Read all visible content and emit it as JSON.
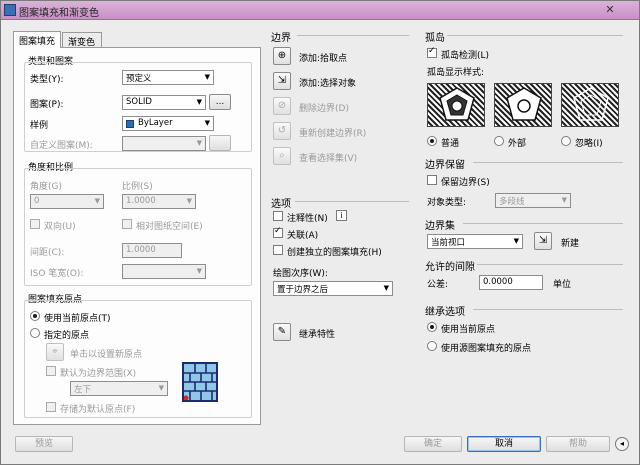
{
  "window": {
    "title": "图案填充和渐变色",
    "close_glyph": "✕"
  },
  "tabs": [
    {
      "label": "图案填充"
    },
    {
      "label": "渐变色"
    }
  ],
  "type_pattern": {
    "group_label": "类型和图案",
    "type_label": "类型(Y):",
    "type_value": "预定义",
    "pattern_label": "图案(P):",
    "pattern_value": "SOLID",
    "pattern_browse": "...",
    "color_label": "样例",
    "color_value": "ByLayer",
    "custom_label": "自定义图案(M):",
    "custom_value": ""
  },
  "angle_scale": {
    "group_label": "角度和比例",
    "angle_label": "角度(G)",
    "angle_value": "0",
    "scale_label": "比例(S)",
    "scale_value": "1.0000",
    "double_label": "双向(U)",
    "relative_label": "相对图纸空间(E)",
    "spacing_label": "间距(C):",
    "spacing_value": "1.0000",
    "iso_label": "ISO 笔宽(O):",
    "iso_value": ""
  },
  "origin": {
    "group_label": "图案填充原点",
    "use_current_label": "使用当前原点(T)",
    "specified_label": "指定的原点",
    "click_set_label": "单击以设置新原点",
    "default_extent_label": "默认为边界范围(X)",
    "position_value": "左下",
    "store_default_label": "存储为默认原点(F)"
  },
  "boundary": {
    "group_label": "边界",
    "add_pick_label": "添加:拾取点",
    "add_select_label": "添加:选择对象",
    "remove_label": "删除边界(D)",
    "recreate_label": "重新创建边界(R)",
    "view_sel_label": "查看选择集(V)"
  },
  "options": {
    "group_label": "选项",
    "annotative_label": "注释性(N)",
    "info_glyph": "i",
    "associative_label": "关联(A)",
    "separate_label": "创建独立的图案填充(H)",
    "draw_order_label": "绘图次序(W):",
    "draw_order_value": "置于边界之后"
  },
  "inherit_label": "继承特性",
  "islands": {
    "group_label": "孤岛",
    "detect_label": "孤岛检测(L)",
    "style_label": "孤岛显示样式:",
    "normal_label": "普通",
    "outer_label": "外部",
    "ignore_label": "忽略(I)"
  },
  "boundary_retain": {
    "group_label": "边界保留",
    "retain_label": "保留边界(S)",
    "object_type_label": "对象类型:",
    "object_type_value": "多段线"
  },
  "boundary_set": {
    "group_label": "边界集",
    "value": "当前视口",
    "new_label": "新建"
  },
  "gap": {
    "group_label": "允许的间隙",
    "tolerance_label": "公差:",
    "tolerance_value": "0.0000",
    "unit_label": "单位"
  },
  "inherit_options": {
    "group_label": "继承选项",
    "use_current_label": "使用当前原点",
    "use_source_label": "使用源图案填充的原点"
  },
  "footer": {
    "preview": "预览",
    "ok": "确定",
    "cancel": "取消",
    "help": "帮助",
    "more_glyph": "◂"
  },
  "colors": {
    "title_bar": "#c98fc6",
    "dialog_bg": "#ececec"
  }
}
